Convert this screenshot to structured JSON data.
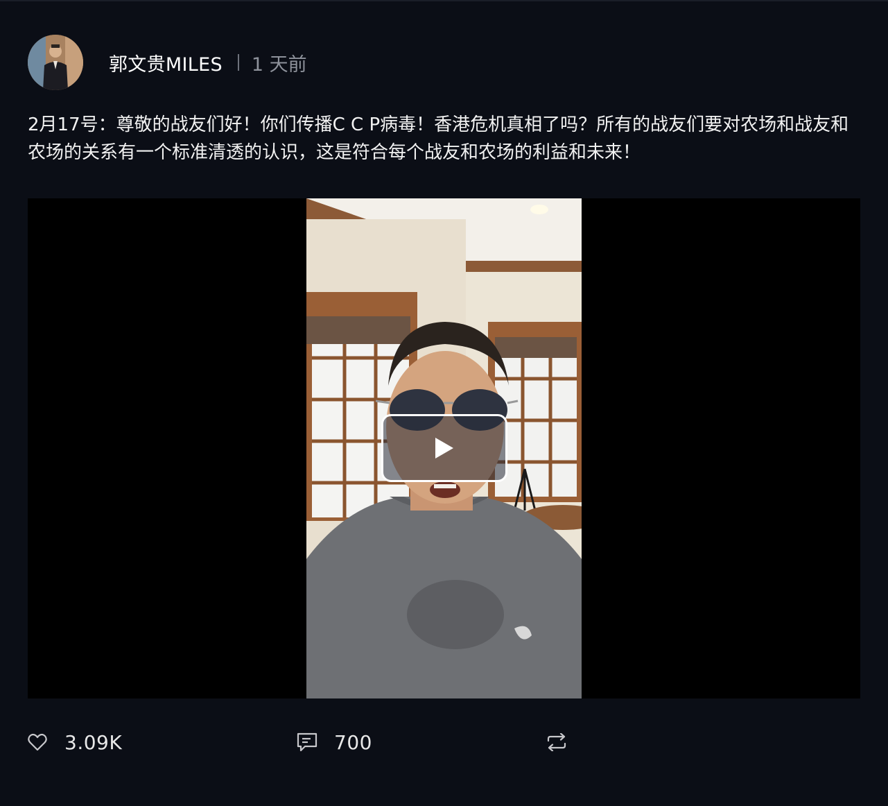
{
  "post": {
    "author": "郭文贵MILES",
    "time": "1 天前",
    "text": "2月17号：尊敬的战友们好！你们传播C C P病毒！香港危机真相了吗？所有的战友们要对农场和战友和农场的关系有一个标准清透的认识，这是符合每个战友和农场的利益和未来！"
  },
  "video": {
    "play_icon": "play-icon"
  },
  "actions": {
    "like_count": "3.09K",
    "comment_count": "700",
    "like_icon": "heart-icon",
    "comment_icon": "comment-icon",
    "share_icon": "repost-icon"
  },
  "colors": {
    "background": "#0b0e16",
    "text": "#ffffff",
    "muted": "#8e929b",
    "video_bg": "#000000"
  }
}
